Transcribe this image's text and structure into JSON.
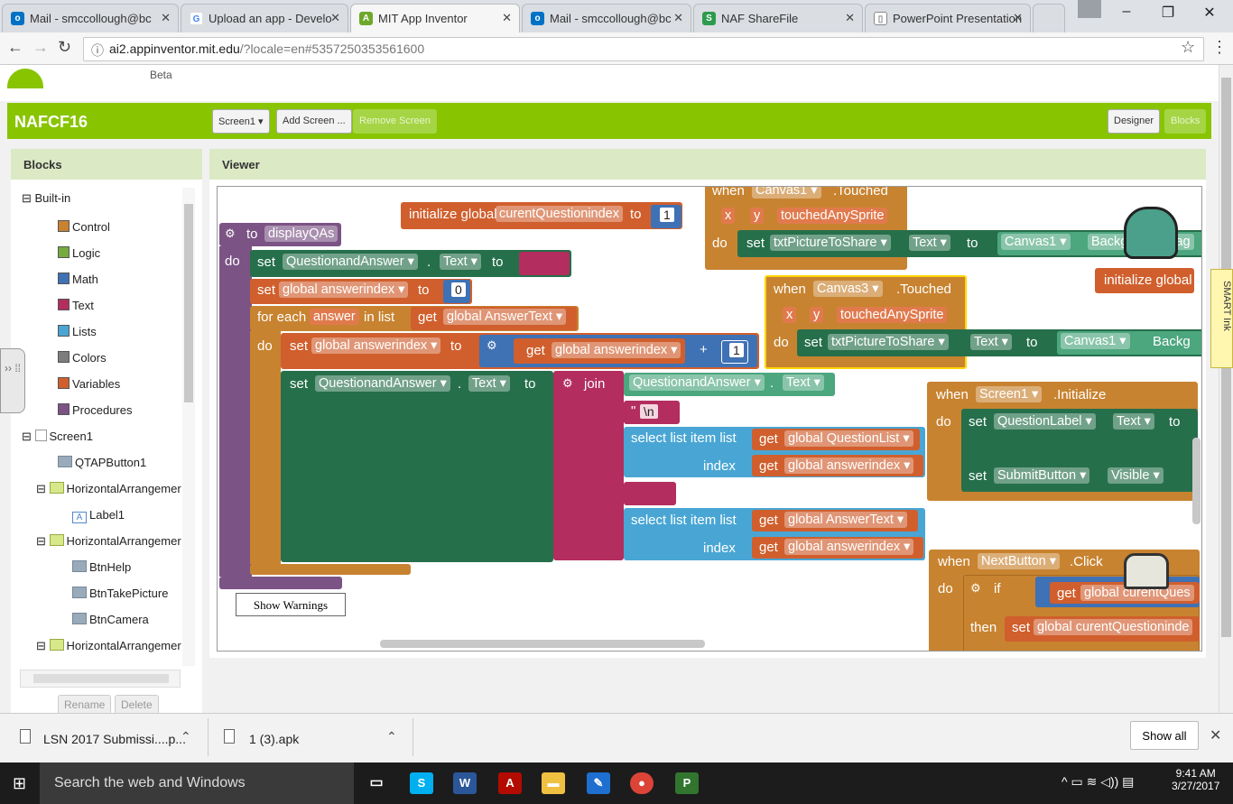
{
  "browser": {
    "tabs": [
      {
        "label": "Mail - smccollough@bc",
        "icon": "outlook-icon",
        "color": "#0072c6"
      },
      {
        "label": "Upload an app - Develo",
        "icon": "google-icon",
        "color": "#4285f4"
      },
      {
        "label": "MIT App Inventor",
        "icon": "appinventor-icon",
        "color": "#6ea82a"
      },
      {
        "label": "Mail - smccollough@bc",
        "icon": "outlook-icon",
        "color": "#0072c6"
      },
      {
        "label": "NAF ShareFile",
        "icon": "sharefile-icon",
        "color": "#2d9b4c"
      },
      {
        "label": "PowerPoint Presentation",
        "icon": "document-icon",
        "color": "#888888"
      }
    ],
    "url_host": "ai2.appinventor.mit.edu",
    "url_path": "/?locale=en#5357250353561600"
  },
  "app": {
    "beta": "Beta",
    "project": "NAFCF16",
    "screen_select": "Screen1 ▾",
    "add_screen": "Add Screen ...",
    "remove_screen": "Remove Screen",
    "designer": "Designer",
    "blocks": "Blocks",
    "accent": "#88c400"
  },
  "blocks_panel": {
    "title": "Blocks",
    "builtin": "Built-in",
    "categories": [
      {
        "label": "Control",
        "color": "#c88330"
      },
      {
        "label": "Logic",
        "color": "#77ab41"
      },
      {
        "label": "Math",
        "color": "#3f71b5"
      },
      {
        "label": "Text",
        "color": "#b32d5e"
      },
      {
        "label": "Lists",
        "color": "#49a6d4"
      },
      {
        "label": "Colors",
        "color": "#7d7d7d"
      },
      {
        "label": "Variables",
        "color": "#d05f2d"
      },
      {
        "label": "Procedures",
        "color": "#7c5385"
      }
    ],
    "components": [
      "Screen1",
      "QTAPButton1",
      "HorizontalArrangemer",
      "Label1",
      "HorizontalArrangemer",
      "BtnHelp",
      "BtnTakePicture",
      "BtnCamera",
      "HorizontalArrangemer"
    ],
    "rename": "Rename",
    "delete": "Delete"
  },
  "viewer": {
    "title": "Viewer",
    "show_warnings": "Show Warnings",
    "b": {
      "init_global": "initialize global",
      "curQ": "curentQuestionindex",
      "to": "to",
      "one": "1",
      "to_proc": "to",
      "proc": "displayQAs",
      "do": "do",
      "set": "set",
      "QA": "QuestionandAnswer ▾",
      "dot": ".",
      "text": "Text ▾",
      "global_ai": "global answerindex ▾",
      "zero": "0",
      "for_each": "for each",
      "answer": "answer",
      "in_list": "in list",
      "get": "get",
      "global_at": "global AnswerText ▾",
      "plus": "+",
      "join": "join",
      "nl": "\\n",
      "select": "select list item  list",
      "index": "index",
      "global_ql": "global QuestionList ▾",
      "when": "when",
      "canvas1": "Canvas1 ▾",
      "touched": ".Touched",
      "x": "x",
      "y": "y",
      "tas": "touchedAnySprite",
      "txtPic": "txtPictureToShare ▾",
      "bgimg": "BackgroundImag",
      "canvas3": "Canvas3 ▾",
      "backg": "Backg",
      "init_global2": "initialize global",
      "screen1": "Screen1 ▾",
      "initialize": ".Initialize",
      "qlabel": "QuestionLabel ▾",
      "submit": "SubmitButton ▾",
      "visible": "Visible ▾",
      "to2": "to",
      "next": "NextButton ▾",
      "click": ".Click",
      "if": "if",
      "getcur": "global curentQues",
      "then": "then",
      "setcur": "global curentQuestioninde"
    }
  },
  "smart_ink": "SMART Ink",
  "downloads": {
    "file1": "LSN 2017 Submissi....p...",
    "file2": "1 (3).apk",
    "show_all": "Show all"
  },
  "taskbar": {
    "search": "Search the web and Windows",
    "time": "9:41 AM",
    "date": "3/27/2017"
  }
}
